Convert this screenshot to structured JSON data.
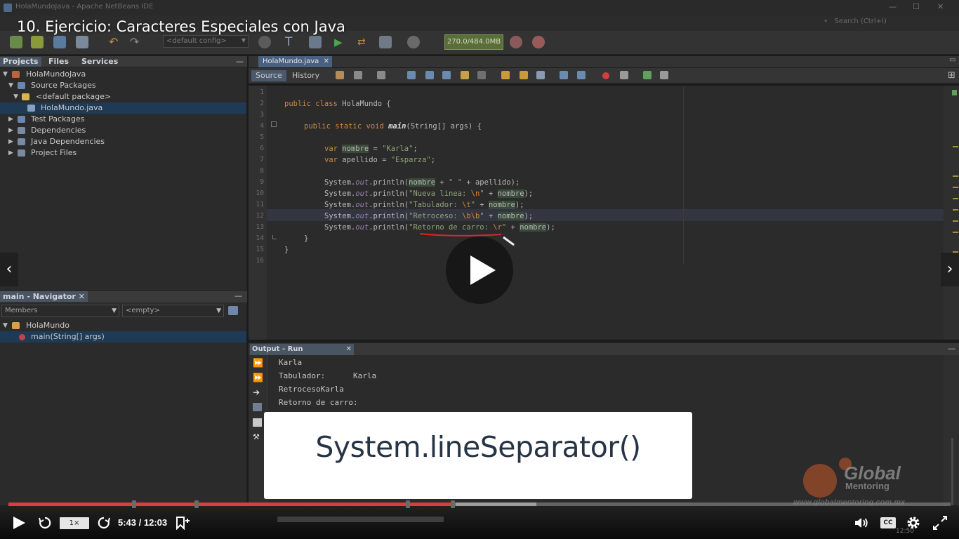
{
  "window": {
    "title": "HolaMundoJava - Apache NetBeans IDE",
    "search_placeholder": "Search (Ctrl+I)"
  },
  "toolbar": {
    "config": "<default config>",
    "memory": "270.0/484.0MB"
  },
  "projects_panel": {
    "tabs": [
      "Projects",
      "Files",
      "Services"
    ],
    "tree": [
      {
        "label": "HolaMundoJava",
        "level": 0,
        "icon": "project-icon",
        "expanded": true
      },
      {
        "label": "Source Packages",
        "level": 1,
        "icon": "source-packages-icon",
        "expanded": true
      },
      {
        "label": "<default package>",
        "level": 2,
        "icon": "package-icon",
        "expanded": true
      },
      {
        "label": "HolaMundo.java",
        "level": 3,
        "icon": "java-file-icon",
        "selected": true
      },
      {
        "label": "Test Packages",
        "level": 1,
        "icon": "test-packages-icon",
        "expanded": false
      },
      {
        "label": "Dependencies",
        "level": 1,
        "icon": "dependencies-icon",
        "expanded": false
      },
      {
        "label": "Java Dependencies",
        "level": 1,
        "icon": "java-dependencies-icon",
        "expanded": false
      },
      {
        "label": "Project Files",
        "level": 1,
        "icon": "project-files-icon",
        "expanded": false
      }
    ]
  },
  "navigator": {
    "tab": "main - Navigator",
    "filter": "Members",
    "scope": "<empty>",
    "class_name": "HolaMundo",
    "member": "main(String[] args)"
  },
  "editor": {
    "tab": "HolaMundo.java",
    "source_label": "Source",
    "history_label": "History",
    "lines": [
      "1",
      "2",
      "3",
      "4",
      "5",
      "6",
      "7",
      "8",
      "9",
      "10",
      "11",
      "12",
      "13",
      "14",
      "15",
      "16"
    ]
  },
  "output": {
    "tab": "Output - Run (HolaMundo...",
    "lines": [
      "Karla",
      "Tabulador:      Karla",
      "RetrocesoKarla",
      "Retorno de carro:"
    ]
  },
  "video": {
    "title": "10. Ejercicio: Caracteres Especiales con Java",
    "caption": "System.lineSeparator()",
    "watermark_brand": "Global",
    "watermark_sub": "Mentoring",
    "watermark_url": "www.globalmentoring.com.mx",
    "time": "5:43 / 12:03",
    "speed": "1×",
    "progress": 0.475,
    "buffered": 0.56,
    "cc_label": "CC"
  },
  "colors": {
    "accent_progress": "#e0393e",
    "keyword": "#cc8a3f",
    "string": "#8fa47a",
    "field": "#9a7fb5"
  }
}
